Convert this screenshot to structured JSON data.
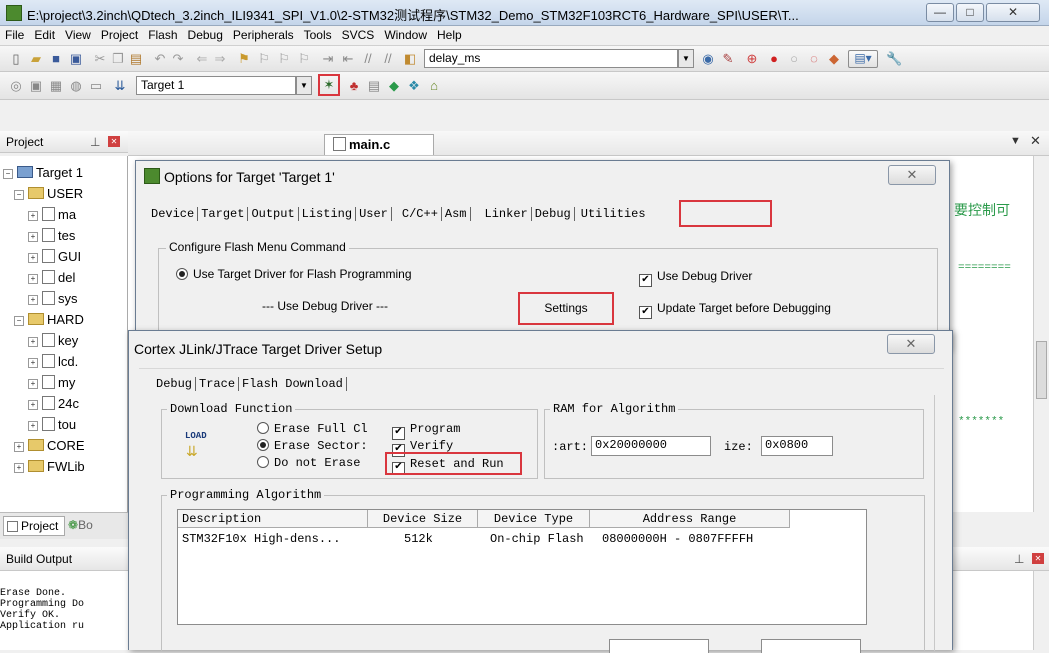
{
  "window": {
    "title": "E:\\project\\3.2inch\\QDtech_3.2inch_ILI9341_SPI_V1.0\\2-STM32测试程序\\STM32_Demo_STM32F103RCT6_Hardware_SPI\\USER\\T...",
    "minimize": "—",
    "maximize": "□",
    "close": "✕"
  },
  "menu": [
    "File",
    "Edit",
    "View",
    "Project",
    "Flash",
    "Debug",
    "Peripherals",
    "Tools",
    "SVCS",
    "Window",
    "Help"
  ],
  "toolbar": {
    "search_value": "delay_ms",
    "target_value": "Target 1"
  },
  "project_panel": {
    "title": "Project",
    "items": [
      {
        "label": "Target 1",
        "level": 0,
        "type": "target"
      },
      {
        "label": "USER",
        "level": 1,
        "type": "folder"
      },
      {
        "label": "ma",
        "level": 2,
        "type": "file"
      },
      {
        "label": "tes",
        "level": 2,
        "type": "file"
      },
      {
        "label": "GUI",
        "level": 2,
        "type": "file"
      },
      {
        "label": "del",
        "level": 2,
        "type": "file"
      },
      {
        "label": "sys",
        "level": 2,
        "type": "file"
      },
      {
        "label": "HARD",
        "level": 1,
        "type": "folder"
      },
      {
        "label": "key",
        "level": 2,
        "type": "file"
      },
      {
        "label": "lcd.",
        "level": 2,
        "type": "file"
      },
      {
        "label": "my",
        "level": 2,
        "type": "file"
      },
      {
        "label": "24c",
        "level": 2,
        "type": "file"
      },
      {
        "label": "tou",
        "level": 2,
        "type": "file"
      },
      {
        "label": "CORE",
        "level": 1,
        "type": "folder"
      },
      {
        "label": "FWLib",
        "level": 1,
        "type": "folder"
      }
    ],
    "bottom_tabs": [
      "Project",
      "Bo"
    ]
  },
  "editor": {
    "tab": "main.c",
    "right_text_1": "要控制可",
    "right_text_2": "========",
    "right_text_3": "*******"
  },
  "options_dialog": {
    "title": "Options for Target 'Target 1'",
    "tabs": [
      "Device",
      "Target",
      "Output",
      "Listing",
      "User",
      "C/C++",
      "Asm",
      "Linker",
      "Debug",
      "Utilities"
    ],
    "group_label": "Configure Flash Menu Command",
    "use_target_driver": "Use Target Driver for Flash Programming",
    "use_debug_driver_dropdown": "--- Use Debug Driver ---",
    "settings_button": "Settings",
    "use_debug_driver_check": "Use Debug Driver",
    "update_target": "Update Target before Debugging"
  },
  "driver_dialog": {
    "title": "Cortex JLink/JTrace Target Driver Setup",
    "tabs": [
      "Debug",
      "Trace",
      "Flash Download"
    ],
    "download_function_label": "Download Function",
    "load_icon_text": "LOAD",
    "erase_full": "Erase Full Cl",
    "erase_sectors": "Erase Sector:",
    "do_not_erase": "Do not Erase",
    "program": "Program",
    "verify": "Verify",
    "reset_and_run": "Reset and Run",
    "ram_label": "RAM for Algorithm",
    "start_label": ":art:",
    "start_value": "0x20000000",
    "size_label": "ize:",
    "size_value": "0x0800",
    "programming_algorithm_label": "Programming Algorithm",
    "table_headers": [
      "Description",
      "Device Size",
      "Device Type",
      "Address Range"
    ],
    "table_rows": [
      [
        "STM32F10x High-dens...",
        "512k",
        "On-chip Flash",
        "08000000H - 0807FFFFH"
      ]
    ]
  },
  "build_output": {
    "title": "Build Output",
    "lines": [
      "Erase Done.",
      "Programming Do",
      "Verify OK.",
      "Application ru"
    ]
  }
}
